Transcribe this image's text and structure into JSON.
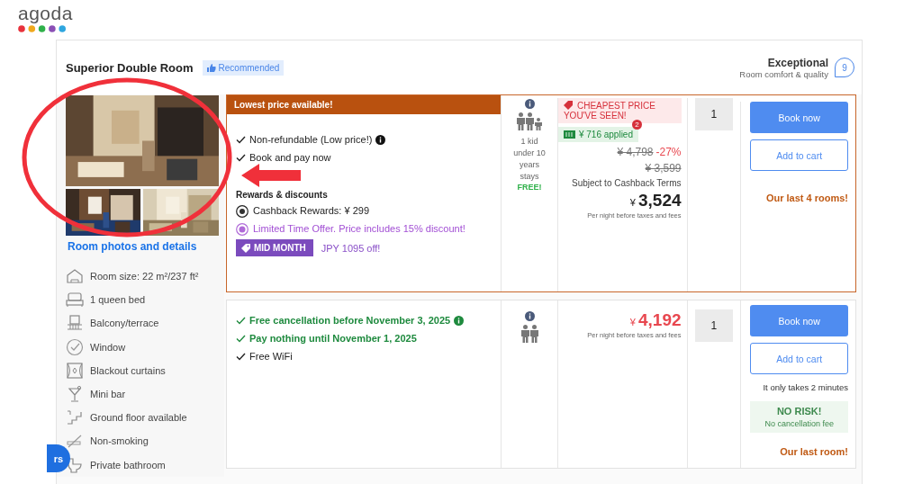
{
  "logo": {
    "text": "agoda"
  },
  "room": {
    "title": "Superior Double Room",
    "badge": "Recommended",
    "rating_label": "Exceptional",
    "rating_caption": "Room comfort & quality",
    "rating_score": "9"
  },
  "photos_link": "Room photos and details",
  "amenities": [
    {
      "text": "Room size: 22 m²/237 ft²"
    },
    {
      "text": "1 queen bed"
    },
    {
      "text": "Balcony/terrace"
    },
    {
      "text": "Window"
    },
    {
      "text": "Blackout curtains"
    },
    {
      "text": "Mini bar"
    },
    {
      "text": "Ground floor available"
    },
    {
      "text": "Non-smoking"
    },
    {
      "text": "Private bathroom"
    }
  ],
  "offers": [
    {
      "highlighted": true,
      "banner": "Lowest price available!",
      "features": [
        {
          "kind": "check",
          "text": "Non-refundable (Low price!)",
          "info": true
        },
        {
          "kind": "check",
          "text": "Book and pay now",
          "info": false
        }
      ],
      "rewards_heading": "Rewards & discounts",
      "cashback": "Cashback Rewards:  ¥ 299",
      "limited_offer": "Limited Time Offer. Price includes 15% discount!",
      "promo_badge": "MID MONTH",
      "promo_text": "JPY 1095 off!",
      "guests": [
        {
          "kind": "adult"
        },
        {
          "kind": "adult"
        },
        {
          "kind": "child"
        }
      ],
      "guest_note": "1 kid under 10 years stays",
      "guest_free": "FREE!",
      "cheapest_tag": "CHEAPEST PRICE YOU'VE SEEN!",
      "coupon": "¥ 716 applied",
      "coupon_count": "2",
      "original_price": "¥ 4,798",
      "discount": "-27%",
      "struck_price": "¥ 3,599",
      "price_note": "Subject to Cashback Terms",
      "currency": "¥",
      "price": "3,524",
      "price_red": false,
      "per_night": "Per night before taxes and fees",
      "quantity": "1",
      "book_button": "Book now",
      "cart_button": "Add to cart",
      "scarcity": "Our last 4 rooms!"
    },
    {
      "highlighted": false,
      "features": [
        {
          "kind": "green",
          "text": "Free cancellation before November 3, 2025",
          "info": true
        },
        {
          "kind": "green",
          "text": "Pay nothing until November 1, 2025",
          "info": false
        },
        {
          "kind": "check",
          "text": "Free WiFi",
          "info": false
        }
      ],
      "guests": [
        {
          "kind": "adult"
        },
        {
          "kind": "adult"
        }
      ],
      "currency": "¥",
      "price": "4,192",
      "price_red": true,
      "per_night": "Per night before taxes and fees",
      "quantity": "1",
      "book_button": "Book now",
      "cart_button": "Add to cart",
      "speed_note": "It only takes 2 minutes",
      "risk_title": "NO RISK!",
      "risk_text": "No cancellation fee",
      "scarcity": "Our last room!"
    }
  ],
  "floating_button": "rs"
}
